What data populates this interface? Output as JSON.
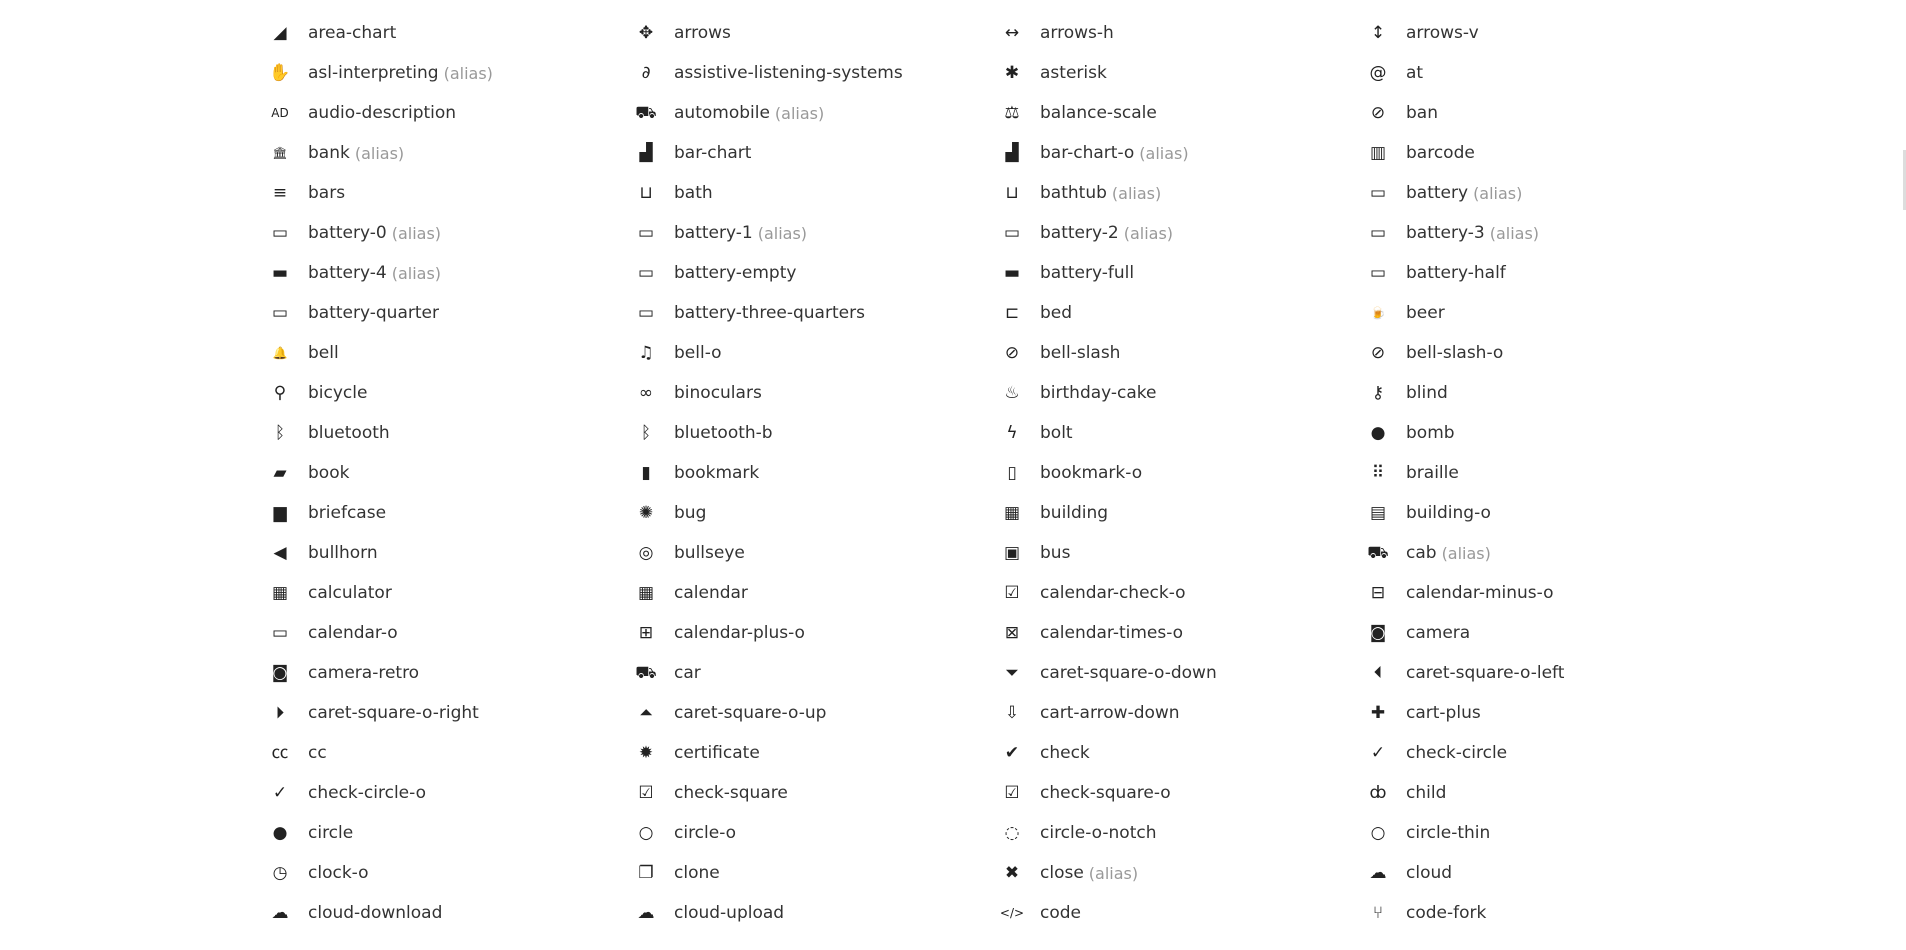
{
  "icon_list": {
    "alias_label": "(alias)",
    "items": [
      {
        "name": "area-chart",
        "icon": "area-chart-icon",
        "glyph": "◢",
        "alias": false
      },
      {
        "name": "arrows",
        "icon": "arrows-icon",
        "glyph": "✥",
        "alias": false
      },
      {
        "name": "arrows-h",
        "icon": "arrows-h-icon",
        "glyph": "↔",
        "alias": false
      },
      {
        "name": "arrows-v",
        "icon": "arrows-v-icon",
        "glyph": "↕",
        "alias": false
      },
      {
        "name": "asl-interpreting",
        "icon": "asl-interpreting-icon",
        "glyph": "✋",
        "alias": true
      },
      {
        "name": "assistive-listening-systems",
        "icon": "assistive-listening-systems-icon",
        "glyph": "∂",
        "alias": false
      },
      {
        "name": "asterisk",
        "icon": "asterisk-icon",
        "glyph": "✱",
        "alias": false
      },
      {
        "name": "at",
        "icon": "at-icon",
        "glyph": "@",
        "alias": false
      },
      {
        "name": "audio-description",
        "icon": "audio-description-icon",
        "glyph": "AD",
        "alias": false
      },
      {
        "name": "automobile",
        "icon": "automobile-icon",
        "glyph": "⛟",
        "alias": true
      },
      {
        "name": "balance-scale",
        "icon": "balance-scale-icon",
        "glyph": "⚖",
        "alias": false
      },
      {
        "name": "ban",
        "icon": "ban-icon",
        "glyph": "⊘",
        "alias": false
      },
      {
        "name": "bank",
        "icon": "bank-icon",
        "glyph": "🏛",
        "alias": true
      },
      {
        "name": "bar-chart",
        "icon": "bar-chart-icon",
        "glyph": "▟",
        "alias": false
      },
      {
        "name": "bar-chart-o",
        "icon": "bar-chart-o-icon",
        "glyph": "▟",
        "alias": true
      },
      {
        "name": "barcode",
        "icon": "barcode-icon",
        "glyph": "▥",
        "alias": false
      },
      {
        "name": "bars",
        "icon": "bars-icon",
        "glyph": "≡",
        "alias": false
      },
      {
        "name": "bath",
        "icon": "bath-icon",
        "glyph": "⊔",
        "alias": false
      },
      {
        "name": "bathtub",
        "icon": "bathtub-icon",
        "glyph": "⊔",
        "alias": true
      },
      {
        "name": "battery",
        "icon": "battery-icon",
        "glyph": "▭",
        "alias": true
      },
      {
        "name": "battery-0",
        "icon": "battery-0-icon",
        "glyph": "▭",
        "alias": true
      },
      {
        "name": "battery-1",
        "icon": "battery-1-icon",
        "glyph": "▭",
        "alias": true
      },
      {
        "name": "battery-2",
        "icon": "battery-2-icon",
        "glyph": "▭",
        "alias": true
      },
      {
        "name": "battery-3",
        "icon": "battery-3-icon",
        "glyph": "▭",
        "alias": true
      },
      {
        "name": "battery-4",
        "icon": "battery-4-icon",
        "glyph": "▬",
        "alias": true
      },
      {
        "name": "battery-empty",
        "icon": "battery-empty-icon",
        "glyph": "▭",
        "alias": false
      },
      {
        "name": "battery-full",
        "icon": "battery-full-icon",
        "glyph": "▬",
        "alias": false
      },
      {
        "name": "battery-half",
        "icon": "battery-half-icon",
        "glyph": "▭",
        "alias": false
      },
      {
        "name": "battery-quarter",
        "icon": "battery-quarter-icon",
        "glyph": "▭",
        "alias": false
      },
      {
        "name": "battery-three-quarters",
        "icon": "battery-three-quarters-icon",
        "glyph": "▭",
        "alias": false
      },
      {
        "name": "bed",
        "icon": "bed-icon",
        "glyph": "⊏",
        "alias": false
      },
      {
        "name": "beer",
        "icon": "beer-icon",
        "glyph": "🍺",
        "alias": false
      },
      {
        "name": "bell",
        "icon": "bell-icon",
        "glyph": "🔔",
        "alias": false
      },
      {
        "name": "bell-o",
        "icon": "bell-o-icon",
        "glyph": "♫",
        "alias": false
      },
      {
        "name": "bell-slash",
        "icon": "bell-slash-icon",
        "glyph": "⊘",
        "alias": false
      },
      {
        "name": "bell-slash-o",
        "icon": "bell-slash-o-icon",
        "glyph": "⊘",
        "alias": false
      },
      {
        "name": "bicycle",
        "icon": "bicycle-icon",
        "glyph": "⚲",
        "alias": false
      },
      {
        "name": "binoculars",
        "icon": "binoculars-icon",
        "glyph": "∞",
        "alias": false
      },
      {
        "name": "birthday-cake",
        "icon": "birthday-cake-icon",
        "glyph": "♨",
        "alias": false
      },
      {
        "name": "blind",
        "icon": "blind-icon",
        "glyph": "⚷",
        "alias": false
      },
      {
        "name": "bluetooth",
        "icon": "bluetooth-icon",
        "glyph": "ᛒ",
        "alias": false
      },
      {
        "name": "bluetooth-b",
        "icon": "bluetooth-b-icon",
        "glyph": "ᛒ",
        "alias": false
      },
      {
        "name": "bolt",
        "icon": "bolt-icon",
        "glyph": "ϟ",
        "alias": false
      },
      {
        "name": "bomb",
        "icon": "bomb-icon",
        "glyph": "●",
        "alias": false
      },
      {
        "name": "book",
        "icon": "book-icon",
        "glyph": "▰",
        "alias": false
      },
      {
        "name": "bookmark",
        "icon": "bookmark-icon",
        "glyph": "▮",
        "alias": false
      },
      {
        "name": "bookmark-o",
        "icon": "bookmark-o-icon",
        "glyph": "▯",
        "alias": false
      },
      {
        "name": "braille",
        "icon": "braille-icon",
        "glyph": "⠿",
        "alias": false
      },
      {
        "name": "briefcase",
        "icon": "briefcase-icon",
        "glyph": "▆",
        "alias": false
      },
      {
        "name": "bug",
        "icon": "bug-icon",
        "glyph": "✺",
        "alias": false
      },
      {
        "name": "building",
        "icon": "building-icon",
        "glyph": "▦",
        "alias": false
      },
      {
        "name": "building-o",
        "icon": "building-o-icon",
        "glyph": "▤",
        "alias": false
      },
      {
        "name": "bullhorn",
        "icon": "bullhorn-icon",
        "glyph": "◀",
        "alias": false
      },
      {
        "name": "bullseye",
        "icon": "bullseye-icon",
        "glyph": "◎",
        "alias": false
      },
      {
        "name": "bus",
        "icon": "bus-icon",
        "glyph": "▣",
        "alias": false
      },
      {
        "name": "cab",
        "icon": "cab-icon",
        "glyph": "⛟",
        "alias": true
      },
      {
        "name": "calculator",
        "icon": "calculator-icon",
        "glyph": "▦",
        "alias": false
      },
      {
        "name": "calendar",
        "icon": "calendar-icon",
        "glyph": "▦",
        "alias": false
      },
      {
        "name": "calendar-check-o",
        "icon": "calendar-check-o-icon",
        "glyph": "☑",
        "alias": false
      },
      {
        "name": "calendar-minus-o",
        "icon": "calendar-minus-o-icon",
        "glyph": "⊟",
        "alias": false
      },
      {
        "name": "calendar-o",
        "icon": "calendar-o-icon",
        "glyph": "▭",
        "alias": false
      },
      {
        "name": "calendar-plus-o",
        "icon": "calendar-plus-o-icon",
        "glyph": "⊞",
        "alias": false
      },
      {
        "name": "calendar-times-o",
        "icon": "calendar-times-o-icon",
        "glyph": "⊠",
        "alias": false
      },
      {
        "name": "camera",
        "icon": "camera-icon",
        "glyph": "◙",
        "alias": false
      },
      {
        "name": "camera-retro",
        "icon": "camera-retro-icon",
        "glyph": "◙",
        "alias": false
      },
      {
        "name": "car",
        "icon": "car-icon",
        "glyph": "⛟",
        "alias": false
      },
      {
        "name": "caret-square-o-down",
        "icon": "caret-square-o-down-icon",
        "glyph": "⏷",
        "alias": false
      },
      {
        "name": "caret-square-o-left",
        "icon": "caret-square-o-left-icon",
        "glyph": "⏴",
        "alias": false
      },
      {
        "name": "caret-square-o-right",
        "icon": "caret-square-o-right-icon",
        "glyph": "⏵",
        "alias": false
      },
      {
        "name": "caret-square-o-up",
        "icon": "caret-square-o-up-icon",
        "glyph": "⏶",
        "alias": false
      },
      {
        "name": "cart-arrow-down",
        "icon": "cart-arrow-down-icon",
        "glyph": "⇩",
        "alias": false
      },
      {
        "name": "cart-plus",
        "icon": "cart-plus-icon",
        "glyph": "✚",
        "alias": false
      },
      {
        "name": "cc",
        "icon": "cc-icon",
        "glyph": "㏄",
        "alias": false
      },
      {
        "name": "certificate",
        "icon": "certificate-icon",
        "glyph": "✹",
        "alias": false
      },
      {
        "name": "check",
        "icon": "check-icon",
        "glyph": "✔",
        "alias": false
      },
      {
        "name": "check-circle",
        "icon": "check-circle-icon",
        "glyph": "✓",
        "alias": false
      },
      {
        "name": "check-circle-o",
        "icon": "check-circle-o-icon",
        "glyph": "✓",
        "alias": false
      },
      {
        "name": "check-square",
        "icon": "check-square-icon",
        "glyph": "☑",
        "alias": false
      },
      {
        "name": "check-square-o",
        "icon": "check-square-o-icon",
        "glyph": "☑",
        "alias": false
      },
      {
        "name": "child",
        "icon": "child-icon",
        "glyph": "ȸ",
        "alias": false
      },
      {
        "name": "circle",
        "icon": "circle-icon",
        "glyph": "●",
        "alias": false
      },
      {
        "name": "circle-o",
        "icon": "circle-o-icon",
        "glyph": "○",
        "alias": false
      },
      {
        "name": "circle-o-notch",
        "icon": "circle-o-notch-icon",
        "glyph": "◌",
        "alias": false
      },
      {
        "name": "circle-thin",
        "icon": "circle-thin-icon",
        "glyph": "○",
        "alias": false
      },
      {
        "name": "clock-o",
        "icon": "clock-o-icon",
        "glyph": "◷",
        "alias": false
      },
      {
        "name": "clone",
        "icon": "clone-icon",
        "glyph": "❐",
        "alias": false
      },
      {
        "name": "close",
        "icon": "close-icon",
        "glyph": "✖",
        "alias": true
      },
      {
        "name": "cloud",
        "icon": "cloud-icon",
        "glyph": "☁",
        "alias": false
      },
      {
        "name": "cloud-download",
        "icon": "cloud-download-icon",
        "glyph": "☁",
        "alias": false
      },
      {
        "name": "cloud-upload",
        "icon": "cloud-upload-icon",
        "glyph": "☁",
        "alias": false
      },
      {
        "name": "code",
        "icon": "code-icon",
        "glyph": "</>",
        "alias": false
      },
      {
        "name": "code-fork",
        "icon": "code-fork-icon",
        "glyph": "⑂",
        "alias": false
      }
    ]
  }
}
